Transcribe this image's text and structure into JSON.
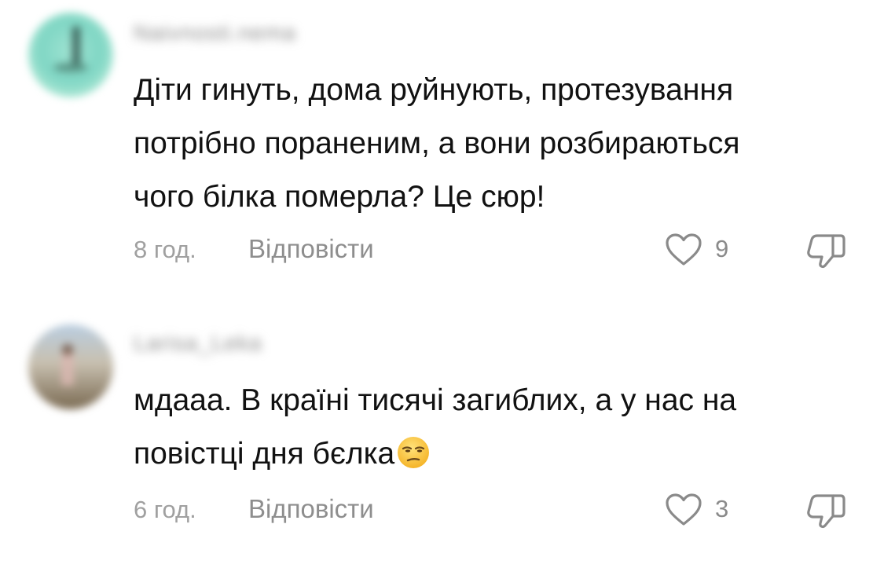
{
  "comments": [
    {
      "username": "Naivnosti.nema",
      "text": "Діти гинуть, дома руйнують, протезування\nпотрібно пораненим, а вони розбираються\nчого білка померла? Це сюр!",
      "time": "8 год.",
      "reply_label": "Відповісти",
      "like_count": "9",
      "avatar_icon": "user-avatar-blurred",
      "like_icon": "heart-outline-icon",
      "dislike_icon": "thumbs-down-icon"
    },
    {
      "username": "Larisa_Leka",
      "text": "мдааа. В країні тисячі загиблих, а у нас на\nповістці дня бєлка",
      "emoji": "unamused-face-emoji",
      "time": "6 год.",
      "reply_label": "Відповісти",
      "like_count": "3",
      "avatar_icon": "user-avatar-blurred",
      "like_icon": "heart-outline-icon",
      "dislike_icon": "thumbs-down-icon"
    }
  ],
  "colors": {
    "text": "#111111",
    "muted": "#8e8e8e",
    "time": "#a0a0a0",
    "icon": "#8a8a8a",
    "background": "#ffffff"
  }
}
